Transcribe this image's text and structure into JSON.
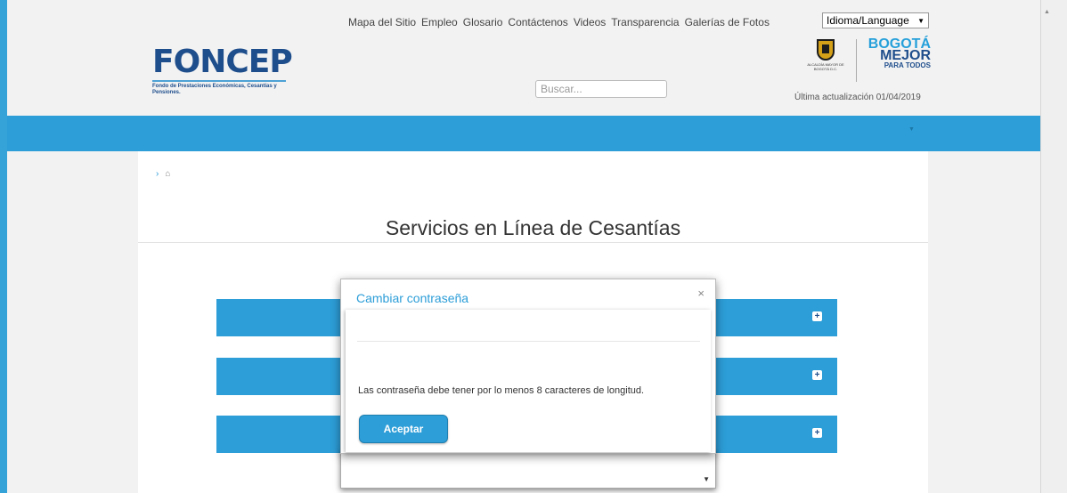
{
  "topnav": {
    "links": [
      "Mapa del Sitio",
      "Empleo",
      "Glosario",
      "Contáctenos",
      "Videos",
      "Transparencia",
      "Galerías de Fotos"
    ],
    "language_select": "Idioma/Language"
  },
  "header": {
    "logo_text": "FONCEP",
    "logo_subtitle": "Fondo de Prestaciones Económicas, Cesantías y Pensiones.",
    "search_placeholder": "Buscar...",
    "seal_caption": "ALCALDÍA MAYOR DE BOGOTÁ D.C.",
    "brand_line1": "BOGOTÁ",
    "brand_line2": "MEJOR",
    "brand_line3": "PARA TODOS",
    "last_updated": "Última actualización 01/04/2019"
  },
  "breadcrumb": {
    "separator": "›",
    "home_icon": "⌂"
  },
  "main": {
    "title": "Servicios en Línea de Cesantías",
    "accordion_count": 3
  },
  "modal": {
    "title": "Cambiar contraseña",
    "close": "×",
    "message": "Las contraseña debe tener por lo menos 8 caracteres de longitud.",
    "button": "Aceptar"
  },
  "colors": {
    "accent": "#2d9ed8",
    "brand_dark": "#1f4e8c"
  }
}
